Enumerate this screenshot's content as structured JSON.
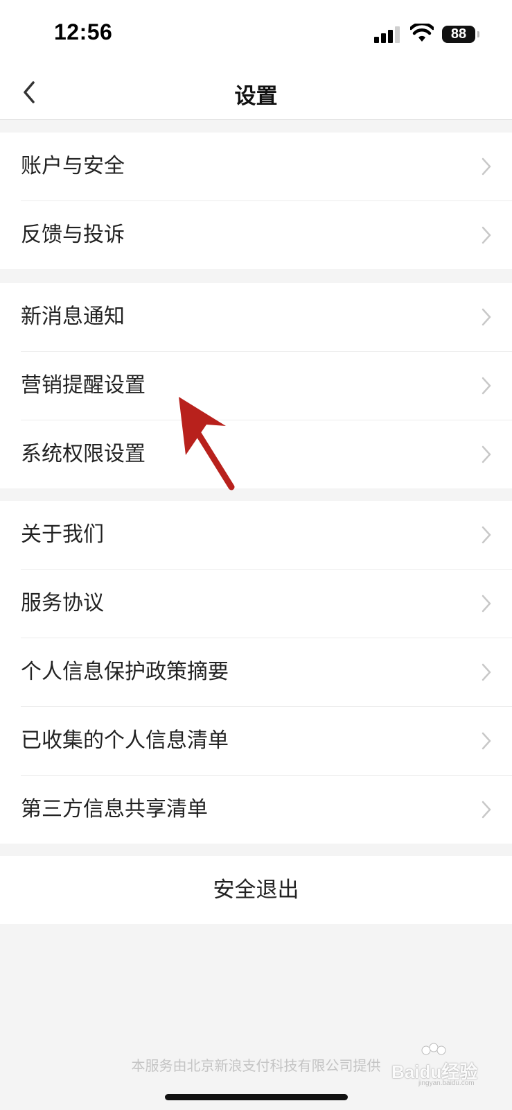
{
  "status_bar": {
    "time": "12:56",
    "battery": "88"
  },
  "nav": {
    "title": "设置"
  },
  "groups": [
    {
      "items": [
        {
          "label": "账户与安全"
        },
        {
          "label": "反馈与投诉"
        }
      ]
    },
    {
      "items": [
        {
          "label": "新消息通知"
        },
        {
          "label": "营销提醒设置"
        },
        {
          "label": "系统权限设置"
        }
      ]
    },
    {
      "items": [
        {
          "label": "关于我们"
        },
        {
          "label": "服务协议"
        },
        {
          "label": "个人信息保护政策摘要"
        },
        {
          "label": "已收集的个人信息清单"
        },
        {
          "label": "第三方信息共享清单"
        }
      ]
    }
  ],
  "logout": {
    "label": "安全退出"
  },
  "footer": {
    "text": "本服务由北京新浪支付科技有限公司提供"
  },
  "watermark": {
    "brand": "Baidu经验",
    "url": "jingyan.baidu.com"
  },
  "colors": {
    "annotation_arrow": "#b8211c",
    "chevron": "#c8c8c8"
  }
}
